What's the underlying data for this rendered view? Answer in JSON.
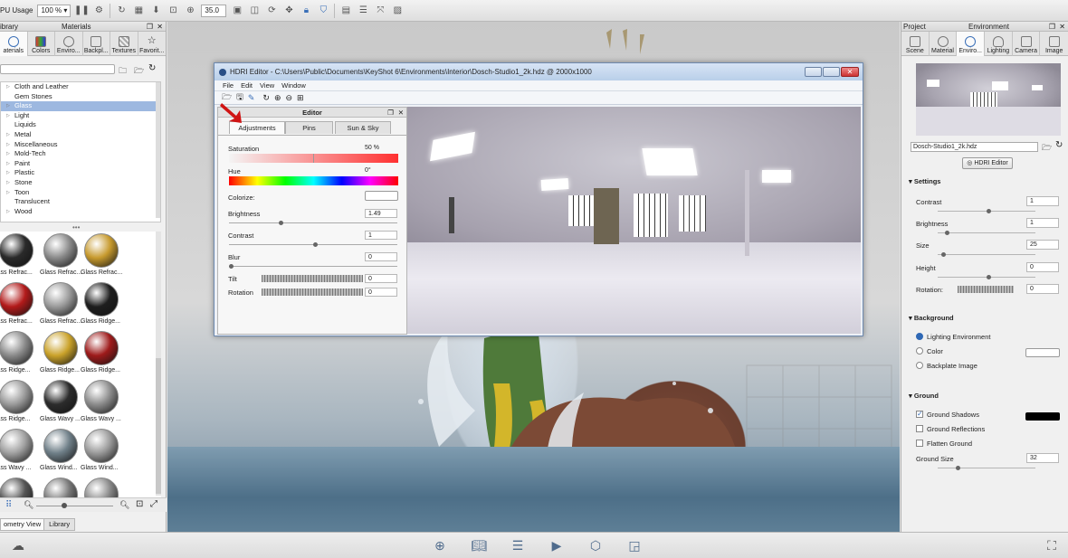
{
  "toolbar": {
    "cpu_label": "PU Usage",
    "cpu_value": "100 %",
    "zoom_value": "35.0"
  },
  "left_panel": {
    "library_label": "ibrary",
    "materials_label": "Materials",
    "tabs": [
      "aterials",
      "Colors",
      "Enviro...",
      "Backpl...",
      "Textures",
      "Favorit..."
    ],
    "tree_items": [
      {
        "label": "Cloth and Leather",
        "arrow": true
      },
      {
        "label": "Gem Stones",
        "arrow": false
      },
      {
        "label": "Glass",
        "arrow": true,
        "selected": true
      },
      {
        "label": "Light",
        "arrow": true
      },
      {
        "label": "Liquids",
        "arrow": false
      },
      {
        "label": "Metal",
        "arrow": true
      },
      {
        "label": "Miscellaneous",
        "arrow": true
      },
      {
        "label": "Mold-Tech",
        "arrow": true
      },
      {
        "label": "Paint",
        "arrow": true
      },
      {
        "label": "Plastic",
        "arrow": true
      },
      {
        "label": "Stone",
        "arrow": true
      },
      {
        "label": "Toon",
        "arrow": true
      },
      {
        "label": "Translucent",
        "arrow": false
      },
      {
        "label": "Wood",
        "arrow": true
      }
    ],
    "thumbnails": [
      {
        "label": "lass Refrac...",
        "color": "#2a2a2a"
      },
      {
        "label": "Glass Refrac...",
        "color": "#8a8a8a"
      },
      {
        "label": "Glass Refrac...",
        "color": "#c79a2e"
      },
      {
        "label": "lass Refrac...",
        "color": "#b21a1a"
      },
      {
        "label": "Glass Refrac...",
        "color": "#9a9a9a"
      },
      {
        "label": "Glass Ridge...",
        "color": "#1e1e1e"
      },
      {
        "label": "lass Ridge...",
        "color": "#8a8a8a"
      },
      {
        "label": "Glass Ridge...",
        "color": "#caa22a"
      },
      {
        "label": "Glass Ridge...",
        "color": "#9e1b1b"
      },
      {
        "label": "lass Ridge...",
        "color": "#9a9a9a"
      },
      {
        "label": "Glass Wavy ...",
        "color": "#2c2c2c"
      },
      {
        "label": "Glass Wavy ...",
        "color": "#8c8c8c"
      },
      {
        "label": "lass Wavy ...",
        "color": "#a0a0a0"
      },
      {
        "label": "Glass Wind...",
        "color": "#6f7f88"
      },
      {
        "label": "Glass Wind...",
        "color": "#9a9a9a"
      },
      {
        "label": "",
        "color": "#555555"
      },
      {
        "label": "",
        "color": "#777777"
      },
      {
        "label": "",
        "color": "#888888"
      }
    ],
    "bottom_tabs": [
      "ometry View",
      "Library"
    ]
  },
  "hdri_editor": {
    "title": "HDRI Editor - C:\\Users\\Public\\Documents\\KeyShot 6\\Environments\\Interior\\Dosch-Studio1_2k.hdz @ 2000x1000",
    "menu": [
      "File",
      "Edit",
      "View",
      "Window"
    ],
    "panel_title": "Editor",
    "tabs": [
      "Adjustments",
      "Pins",
      "Sun & Sky"
    ],
    "saturation_label": "Saturation",
    "saturation_value": "50 %",
    "hue_label": "Hue",
    "hue_value": "0°",
    "colorize_label": "Colorize:",
    "brightness_label": "Brightness",
    "brightness_value": "1.49",
    "contrast_label": "Contrast",
    "contrast_value": "1",
    "blur_label": "Blur",
    "blur_value": "0",
    "tilt_label": "Tilt",
    "tilt_value": "0",
    "rotation_label": "Rotation",
    "rotation_value": "0"
  },
  "right_panel": {
    "project_label": "Project",
    "environment_label": "Environment",
    "tabs": [
      "Scene",
      "Material",
      "Enviro...",
      "Lighting",
      "Camera",
      "Image"
    ],
    "env_file": "Dosch-Studio1_2k.hdz",
    "hdri_button": "HDRI Editor",
    "settings_header": "Settings",
    "contrast_label": "Contrast",
    "contrast_value": "1",
    "brightness_label": "Brightness",
    "brightness_value": "1",
    "size_label": "Size",
    "size_value": "25",
    "height_label": "Height",
    "height_value": "0",
    "rotation_label": "Rotation:",
    "rotation_value": "0",
    "background_header": "Background",
    "bg_lighting": "Lighting Environment",
    "bg_color": "Color",
    "bg_backplate": "Backplate Image",
    "ground_header": "Ground",
    "ground_shadows": "Ground Shadows",
    "ground_reflections": "Ground Reflections",
    "flatten_ground": "Flatten Ground",
    "ground_size_label": "Ground Size",
    "ground_size_value": "32"
  },
  "colors": {
    "accent_arrow": "#d01414",
    "selection": "#9db8e0",
    "bottom_icons": "#4f6b8c"
  }
}
